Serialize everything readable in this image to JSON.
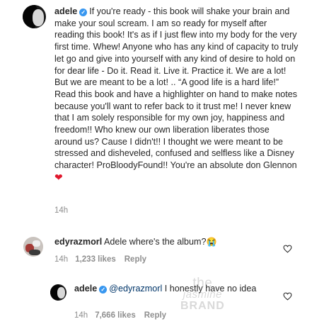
{
  "post": {
    "username": "adele",
    "caption": "If you're ready - this book will shake your brain and make your soul scream. I am so ready for myself after reading this book! It's as if I just flew into my body for the very first time. Whew! Anyone who has any kind of capacity to truly let go and give into yourself with any kind of desire to hold on for dear life - Do it. Read it. Live it. Practice it. We are a lot! But we are meant to be a lot! .. “A good life is a hard life!” Read this book and have a highlighter on hand to make notes because you'll want to refer back to it trust me! I never knew that I am solely responsible for my own joy, happiness and freedom!! Who knew our own liberation liberates those around us? Cause I didn't!! I thought we were meant to be stressed and disheveled, confused and selfless like a Disney character! ProBloodyFound!! You're an absolute don Glennon",
    "emoji": "❤",
    "time": "14h"
  },
  "comments": [
    {
      "username": "edyrazmorl",
      "text": "Adele where's the album?",
      "emoji": "😭",
      "time": "14h",
      "likes": "1,233 likes",
      "reply": "Reply"
    },
    {
      "username": "adele",
      "mention": "@edyrazmorl",
      "text": " I honestly have no idea",
      "time": "14h",
      "likes": "7,666 likes",
      "reply": "Reply"
    }
  ],
  "watermark": {
    "line1": "the",
    "line2": "jasmine",
    "line3": "BRAND"
  },
  "icons": {
    "verified": "verified-badge-icon",
    "like": "heart-outline-icon"
  },
  "colors": {
    "verified": "#3897f0",
    "heart": "#e0182d",
    "muted": "#8e8e8e"
  }
}
